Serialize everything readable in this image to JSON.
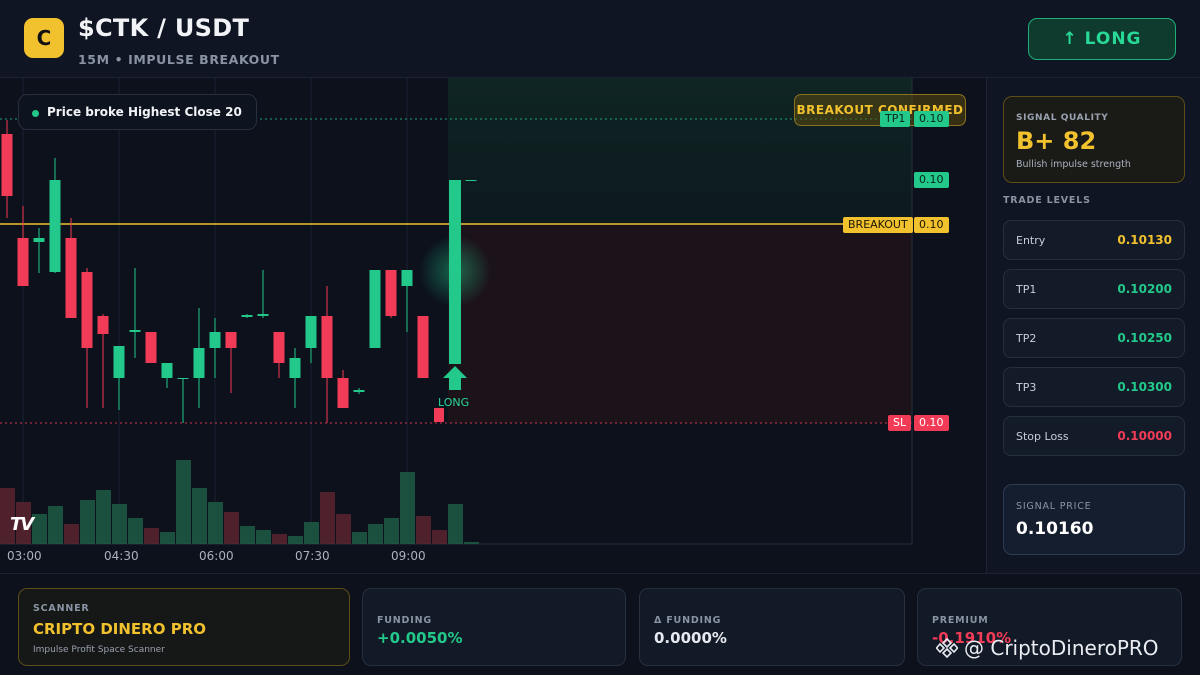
{
  "header": {
    "logo_letter": "C",
    "title": "$CTK / USDT",
    "subtitle": "15M • IMPULSE BREAKOUT",
    "long_button": "↑ LONG"
  },
  "chart": {
    "price_note": "Price broke Highest Close 20",
    "breakout_badge": "BREAKOUT CONFIRMED",
    "tags": {
      "tp1_label": "TP1",
      "tp1_value": "0.10",
      "current_value": "0.10",
      "breakout_label": "BREAKOUT",
      "breakout_value": "0.10",
      "sl_label": "SL",
      "sl_value": "0.10"
    },
    "long_marker": "LONG",
    "time_labels": [
      "03:00",
      "04:30",
      "06:00",
      "07:30",
      "09:00"
    ],
    "colors": {
      "up": "#22c98a",
      "down": "#f23b56",
      "breakout": "#f2c12e"
    }
  },
  "chart_data": {
    "type": "candlestick",
    "x": [
      "03:00",
      "03:15",
      "03:30",
      "03:45",
      "04:00",
      "04:15",
      "04:30",
      "04:45",
      "05:00",
      "05:15",
      "05:30",
      "05:45",
      "06:00",
      "06:15",
      "06:30",
      "06:45",
      "07:00",
      "07:15",
      "07:30",
      "07:45",
      "08:00",
      "08:15",
      "08:30",
      "08:45",
      "09:00",
      "09:15",
      "09:30",
      "09:45"
    ],
    "levels": {
      "tp1": 0.102,
      "breakout": 0.1013,
      "sl": 0.1,
      "entry": 0.1013
    },
    "xlabel": "",
    "ylabel": ""
  },
  "sidebar": {
    "signal_quality_label": "SIGNAL QUALITY",
    "signal_quality_value": "B+ 82",
    "signal_quality_desc": "Bullish impulse strength",
    "trade_levels_heading": "TRADE LEVELS",
    "trade_levels": [
      {
        "label": "Entry",
        "value": "0.10130",
        "color": "#f2c12e"
      },
      {
        "label": "TP1",
        "value": "0.10200",
        "color": "#22c98a"
      },
      {
        "label": "TP2",
        "value": "0.10250",
        "color": "#22c98a"
      },
      {
        "label": "TP3",
        "value": "0.10300",
        "color": "#22c98a"
      },
      {
        "label": "Stop Loss",
        "value": "0.10000",
        "color": "#f23b56"
      }
    ],
    "signal_price_label": "SIGNAL PRICE",
    "signal_price_value": "0.10160"
  },
  "footer": {
    "scanner_label": "SCANNER",
    "scanner_value": "CRIPTO DINERO PRO",
    "scanner_desc": "Impulse Profit Space Scanner",
    "funding_label": "FUNDING",
    "funding_value": "+0.0050%",
    "delta_funding_label": "Δ FUNDING",
    "delta_funding_value": "0.0000%",
    "premium_label": "PREMIUM",
    "premium_value": "-0.1910%",
    "watermark": "@ CriptoDineroPRO"
  }
}
